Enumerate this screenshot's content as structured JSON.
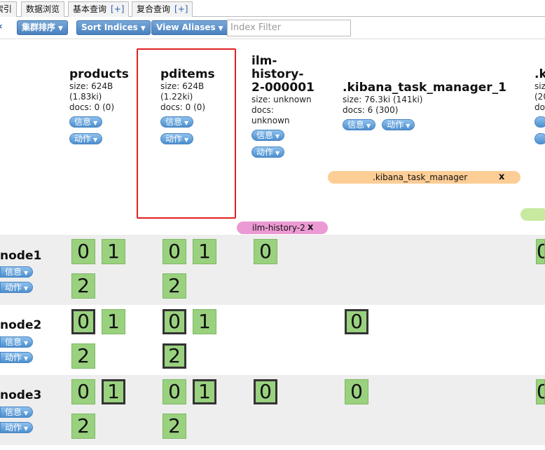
{
  "tabs": [
    {
      "label": "索引",
      "plus": ""
    },
    {
      "label": "数据浏览",
      "plus": ""
    },
    {
      "label": "基本查询",
      "plus": "[+]"
    },
    {
      "label": "复合查询",
      "plus": "[+]"
    }
  ],
  "toolbar": {
    "back_icon": "chevron-left-icon",
    "cluster_sort": "集群排序",
    "sort_indices": "Sort Indices",
    "view_aliases": "View Aliases",
    "filter_placeholder": "Index Filter"
  },
  "buttons": {
    "info": "信息",
    "action": "动作"
  },
  "indices": [
    {
      "name": "products",
      "size": "size: 624B",
      "size2": "(1.83ki)",
      "docs": "docs: 0 (0)",
      "docs2": ""
    },
    {
      "name": "pditems",
      "size": "size: 624B",
      "size2": "(1.22ki)",
      "docs": "docs: 0 (0)",
      "docs2": ""
    },
    {
      "name": "ilm-history-2-000001",
      "name_lines": [
        "ilm-",
        "history-",
        "2-000001"
      ],
      "size": "size: unknown",
      "size2": "",
      "docs": "docs:",
      "docs2": "unknown"
    },
    {
      "name": ".kibana_task_manager_1",
      "size": "size: 76.3ki (141ki)",
      "size2": "",
      "docs": "docs: 6 (300)",
      "docs2": ""
    },
    {
      "name": ".k",
      "size": "siz",
      "size2": "(20",
      "docs": "doc",
      "docs2": ""
    }
  ],
  "aliases": [
    {
      "name": ".kibana_task_manager",
      "close": "x",
      "color": "#fccd95"
    },
    {
      "name": "ilm-history-2",
      "close": "x",
      "color": "#ec9ad4"
    },
    {
      "name": "",
      "close": "",
      "color": "#c7eaa0"
    }
  ],
  "nodes": [
    {
      "name": "node1",
      "shards": [
        {
          "col": 0,
          "labels": [
            "0",
            "1",
            "2"
          ],
          "primary": [
            false,
            false,
            false
          ]
        },
        {
          "col": 1,
          "labels": [
            "0",
            "1",
            "2"
          ],
          "primary": [
            false,
            false,
            false
          ]
        },
        {
          "col": 2,
          "labels": [
            "0"
          ],
          "primary": [
            false
          ]
        },
        {
          "col": 4,
          "labels": [
            "0"
          ],
          "primary": [
            false
          ]
        }
      ]
    },
    {
      "name": "node2",
      "shards": [
        {
          "col": 0,
          "labels": [
            "0",
            "1",
            "2"
          ],
          "primary": [
            true,
            false,
            false
          ]
        },
        {
          "col": 1,
          "labels": [
            "0",
            "1",
            "2"
          ],
          "primary": [
            true,
            false,
            true
          ]
        },
        {
          "col": 3,
          "labels": [
            "0"
          ],
          "primary": [
            true
          ]
        }
      ]
    },
    {
      "name": "node3",
      "shards": [
        {
          "col": 0,
          "labels": [
            "0",
            "1",
            "2"
          ],
          "primary": [
            false,
            true,
            false
          ]
        },
        {
          "col": 1,
          "labels": [
            "0",
            "1",
            "2"
          ],
          "primary": [
            false,
            true,
            false
          ]
        },
        {
          "col": 2,
          "labels": [
            "0"
          ],
          "primary": [
            true
          ]
        },
        {
          "col": 3,
          "labels": [
            "0"
          ],
          "primary": [
            false
          ]
        },
        {
          "col": 4,
          "labels": [
            "0"
          ],
          "primary": [
            false
          ]
        }
      ]
    }
  ]
}
